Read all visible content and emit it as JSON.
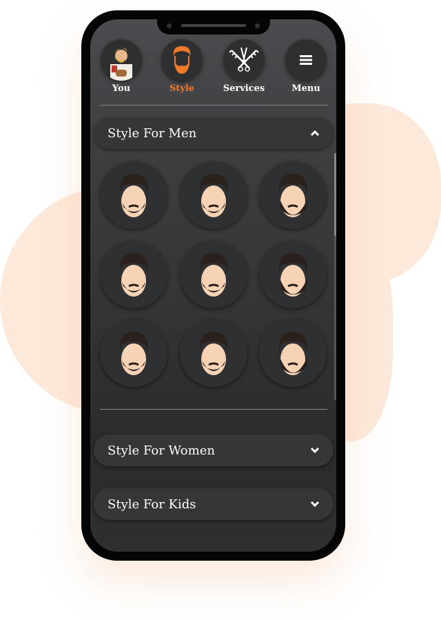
{
  "colors": {
    "accent": "#f07a2a",
    "blob": "#fde9da",
    "panel": "#363637"
  },
  "nav": [
    {
      "label": "You",
      "icon": "barber-avatar-icon"
    },
    {
      "label": "Style",
      "icon": "beard-face-icon",
      "active": true
    },
    {
      "label": "Services",
      "icon": "scissors-comb-icon"
    },
    {
      "label": "Menu",
      "icon": "hamburger-menu-icon"
    }
  ],
  "sections": {
    "men": {
      "title": "Style For Men",
      "expanded": true,
      "styles": 9
    },
    "women": {
      "title": "Style For Women",
      "expanded": false
    },
    "kids": {
      "title": "Style For Kids",
      "expanded": false
    }
  }
}
